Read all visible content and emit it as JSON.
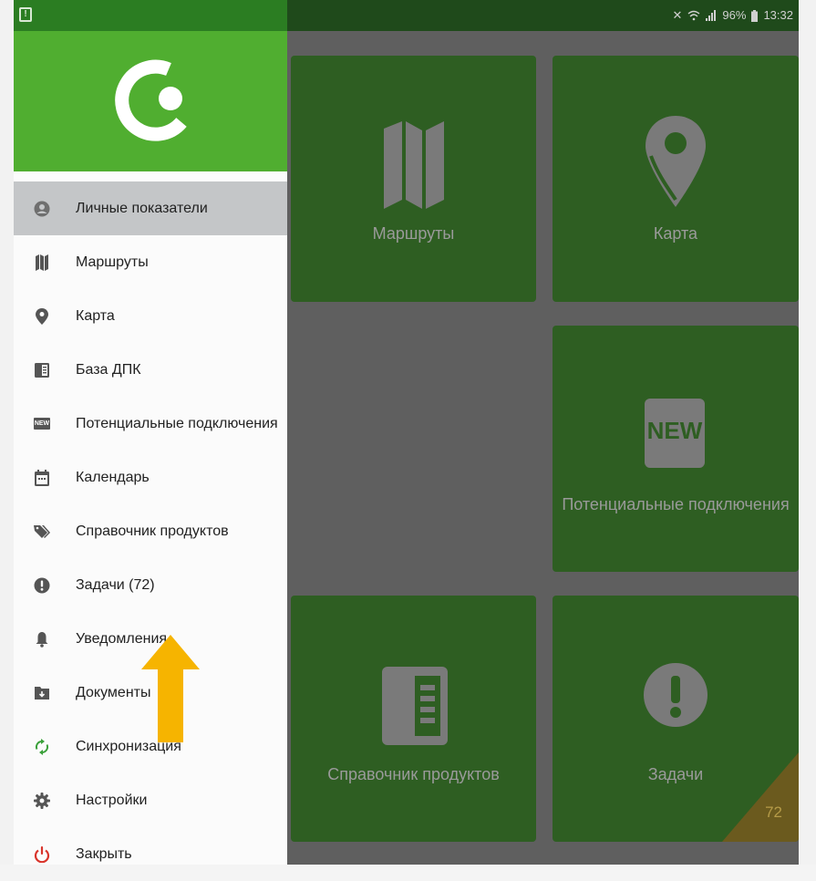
{
  "status_bar": {
    "notification_glyph": "!",
    "mute_glyph": "✕",
    "battery": "96%",
    "time": "13:32"
  },
  "drawer": {
    "items": [
      {
        "label": "Личные показатели",
        "icon": "person-icon",
        "active": true
      },
      {
        "label": "Маршруты",
        "icon": "map-icon"
      },
      {
        "label": "Карта",
        "icon": "location-pin-icon"
      },
      {
        "label": "База ДПК",
        "icon": "book-icon"
      },
      {
        "label": "Потенциальные подключения",
        "icon": "new-badge-icon",
        "icon_text": "NEW"
      },
      {
        "label": "Календарь",
        "icon": "calendar-icon"
      },
      {
        "label": "Справочник продуктов",
        "icon": "tags-icon"
      },
      {
        "label": "Задачи (72)",
        "icon": "alert-circle-icon"
      },
      {
        "label": "Уведомления",
        "icon": "bell-icon"
      },
      {
        "label": "Документы",
        "icon": "folder-download-icon"
      },
      {
        "label": "Синхронизация",
        "icon": "sync-icon"
      },
      {
        "label": "Настройки",
        "icon": "gear-icon"
      },
      {
        "label": "Закрыть",
        "icon": "power-icon"
      }
    ]
  },
  "tiles": {
    "routes": {
      "label": "Маршруты"
    },
    "map": {
      "label": "Карта"
    },
    "potential": {
      "label": "Потенциальные подключения",
      "icon_text": "NEW"
    },
    "catalog": {
      "label": "Справочник продуктов"
    },
    "tasks": {
      "label": "Задачи",
      "badge": "72"
    }
  },
  "colors": {
    "brand_green": "#50ae30",
    "active_item": "#c4c6c8",
    "arrow": "#f6b400",
    "power_red": "#d9342b",
    "sync_green": "#3aa03a"
  }
}
